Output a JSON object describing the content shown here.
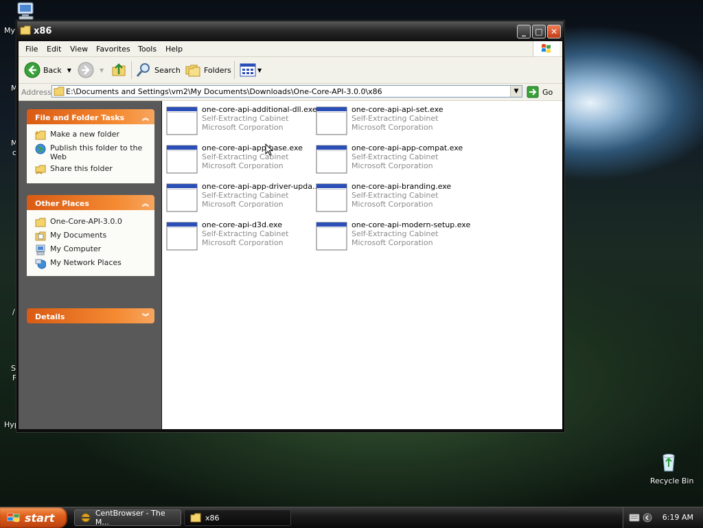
{
  "desktop": {
    "labels": [
      "My",
      "Hyp",
      "Recycle Bin"
    ],
    "fragments": [
      "M",
      "M",
      "c",
      "S",
      "F",
      "/"
    ]
  },
  "window": {
    "title": "x86",
    "controls": {
      "minimize": "_",
      "maximize": "□",
      "close": "✕"
    }
  },
  "menu": [
    "File",
    "Edit",
    "View",
    "Favorites",
    "Tools",
    "Help"
  ],
  "toolbar": {
    "back": "Back",
    "search": "Search",
    "folders": "Folders"
  },
  "address": {
    "label": "Address",
    "value": "E:\\Documents and Settings\\vm2\\My Documents\\Downloads\\One-Core-API-3.0.0\\x86",
    "go": "Go"
  },
  "sidebar": {
    "file_tasks": {
      "title": "File and Folder Tasks",
      "items": [
        "Make a new folder",
        "Publish this folder to the Web",
        "Share this folder"
      ]
    },
    "other_places": {
      "title": "Other Places",
      "items": [
        "One-Core-API-3.0.0",
        "My Documents",
        "My Computer",
        "My Network Places"
      ]
    },
    "details": {
      "title": "Details"
    }
  },
  "files": [
    {
      "name": "one-core-api-additional-dll.exe",
      "type": "Self-Extracting Cabinet",
      "company": "Microsoft Corporation"
    },
    {
      "name": "one-core-api-api-set.exe",
      "type": "Self-Extracting Cabinet",
      "company": "Microsoft Corporation"
    },
    {
      "name": "one-core-api-app-base.exe",
      "type": "Self-Extracting Cabinet",
      "company": "Microsoft Corporation"
    },
    {
      "name": "one-core-api-app-compat.exe",
      "type": "Self-Extracting Cabinet",
      "company": "Microsoft Corporation"
    },
    {
      "name": "one-core-api-app-driver-upda...",
      "type": "Self-Extracting Cabinet",
      "company": "Microsoft Corporation"
    },
    {
      "name": "one-core-api-branding.exe",
      "type": "Self-Extracting Cabinet",
      "company": "Microsoft Corporation"
    },
    {
      "name": "one-core-api-d3d.exe",
      "type": "Self-Extracting Cabinet",
      "company": "Microsoft Corporation"
    },
    {
      "name": "one-core-api-modern-setup.exe",
      "type": "Self-Extracting Cabinet",
      "company": "Microsoft Corporation"
    }
  ],
  "taskbar": {
    "start": "start",
    "tasks": [
      "CentBrowser - The M...",
      "x86"
    ],
    "clock": "6:19 AM"
  },
  "colors": {
    "accent_orange": "#f58a32",
    "link_blue": "#0b3d91",
    "selection_blue": "#2c4fb7"
  }
}
